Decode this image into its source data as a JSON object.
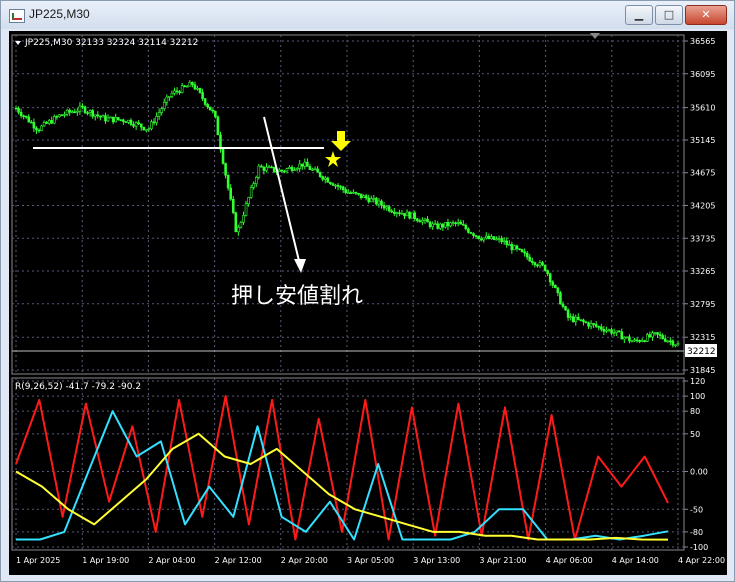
{
  "window": {
    "title": "JP225,M30",
    "minimize_glyph": "▁",
    "maximize_glyph": "□",
    "close_glyph": "✕"
  },
  "price_panel": {
    "header": "JP225,M30  32133 32324 32114 32212",
    "current_price": "32212",
    "y_ticks": [
      "36565",
      "36095",
      "35610",
      "35145",
      "34675",
      "34205",
      "33735",
      "33265",
      "32795",
      "32315",
      "31845"
    ],
    "annotation": "押し安値割れ",
    "marker_icon": "star-icon",
    "arrow_icon": "down-arrow-icon"
  },
  "indicator_panel": {
    "header": "R(9,26,52) -41.7 -79.2 -90.2",
    "y_ticks": [
      "120",
      "100",
      "80",
      "50",
      "0.00",
      "-50",
      "-80",
      "-100"
    ]
  },
  "x_axis": {
    "labels": [
      "1 Apr 2025",
      "1 Apr 19:00",
      "2 Apr 04:00",
      "2 Apr 12:00",
      "2 Apr 20:00",
      "3 Apr 05:00",
      "3 Apr 13:00",
      "3 Apr 21:00",
      "4 Apr 06:00",
      "4 Apr 14:00",
      "4 Apr 22:00"
    ]
  },
  "colors": {
    "background": "#000000",
    "candles": "#33ff33",
    "grid": "#5a5a7a",
    "axis_text": "#ffffff",
    "line_fast": "#ff1a1a",
    "line_mid": "#33e0ff",
    "line_slow": "#ffff33",
    "annotation_line": "#ffffff",
    "marker": "#ffff00"
  },
  "chart_data": [
    {
      "type": "candlestick",
      "title": "JP225,M30",
      "x": [
        "1 Apr 2025",
        "1 Apr 19:00",
        "2 Apr 04:00",
        "2 Apr 12:00",
        "2 Apr 20:00",
        "3 Apr 05:00",
        "3 Apr 13:00",
        "3 Apr 21:00",
        "4 Apr 06:00",
        "4 Apr 14:00",
        "4 Apr 22:00"
      ],
      "series": [
        {
          "values": [
            35600,
            35300,
            35500,
            35600,
            35450,
            35430,
            35300,
            35800,
            35950,
            35500,
            33800,
            34750,
            34700,
            34800,
            34600,
            34400,
            34300,
            34150,
            34050,
            33900,
            33950,
            33750,
            33700,
            33500,
            33300,
            32600,
            32500,
            32400,
            32250,
            32350,
            32212
          ]
        }
      ],
      "ylim": [
        31845,
        36565
      ],
      "current": 32212
    },
    {
      "type": "line",
      "title": "R(9,26,52)",
      "x": [
        "1 Apr 2025",
        "1 Apr 19:00",
        "2 Apr 04:00",
        "2 Apr 12:00",
        "2 Apr 20:00",
        "3 Apr 05:00",
        "3 Apr 13:00",
        "3 Apr 21:00",
        "4 Apr 06:00",
        "4 Apr 14:00",
        "4 Apr 22:00"
      ],
      "series": [
        {
          "values": [
            10,
            95,
            -60,
            90,
            -40,
            60,
            -80,
            95,
            -60,
            100,
            -70,
            95,
            -90,
            70,
            -80,
            95,
            -90,
            85,
            -85,
            90,
            -85,
            85,
            -90,
            75,
            -90,
            20,
            -20,
            20,
            -41.7
          ]
        },
        {
          "values": [
            -90,
            -90,
            -80,
            0,
            80,
            20,
            40,
            -70,
            -20,
            -60,
            60,
            -60,
            -80,
            -40,
            -90,
            10,
            -90,
            -90,
            -90,
            -80,
            -50,
            -50,
            -90,
            -90,
            -85,
            -90,
            -85,
            -79.2
          ]
        },
        {
          "values": [
            0,
            -20,
            -50,
            -70,
            -40,
            -10,
            30,
            50,
            20,
            10,
            30,
            0,
            -30,
            -50,
            -60,
            -70,
            -80,
            -80,
            -85,
            -85,
            -90,
            -90,
            -90,
            -88,
            -90,
            -90.2
          ]
        }
      ],
      "ylim": [
        -100,
        120
      ],
      "last_values": [
        -41.7,
        -79.2,
        -90.2
      ]
    }
  ]
}
